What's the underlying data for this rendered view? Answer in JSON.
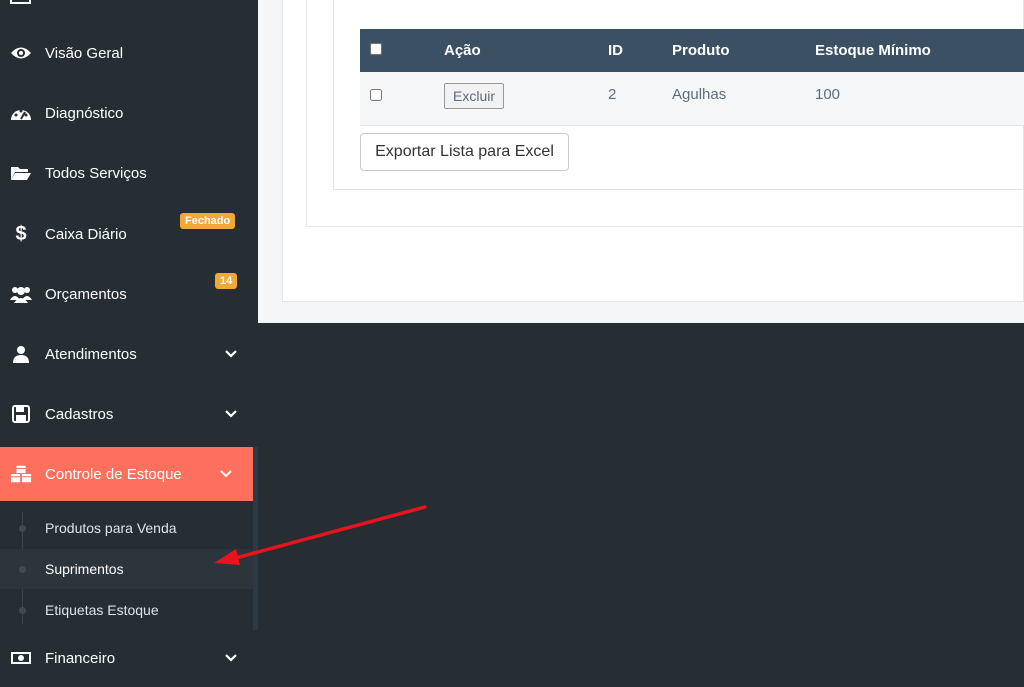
{
  "sidebar": {
    "items": [
      {
        "label": "Visão Geral",
        "icon": "eye-icon"
      },
      {
        "label": "Diagnóstico",
        "icon": "gauge-icon"
      },
      {
        "label": "Todos Serviços",
        "icon": "folder-open-icon"
      },
      {
        "label": "Caixa Diário",
        "icon": "dollar-icon",
        "badge": "Fechado"
      },
      {
        "label": "Orçamentos",
        "icon": "users-icon",
        "badge": "14"
      },
      {
        "label": "Atendimentos",
        "icon": "user-icon"
      },
      {
        "label": "Cadastros",
        "icon": "floppy-disk-icon"
      },
      {
        "label": "Controle de Estoque",
        "icon": "cubes-icon"
      },
      {
        "label": "Financeiro",
        "icon": "money-bill-icon"
      }
    ],
    "submenu": [
      {
        "label": "Produtos para Venda"
      },
      {
        "label": "Suprimentos"
      },
      {
        "label": "Etiquetas Estoque"
      }
    ]
  },
  "table": {
    "headers": [
      "Ação",
      "ID",
      "Produto",
      "Estoque Mínimo"
    ],
    "rows": [
      {
        "action_label": "Excluir",
        "id": "2",
        "produto": "Agulhas",
        "estoque_minimo": "100"
      }
    ]
  },
  "export_label": "Exportar Lista para Excel",
  "colors": {
    "sidebar_bg": "#262d33",
    "active_item": "#ff6f5e",
    "table_header": "#3c5064",
    "badge": "#f0a83a",
    "arrow": "#e8141b"
  }
}
